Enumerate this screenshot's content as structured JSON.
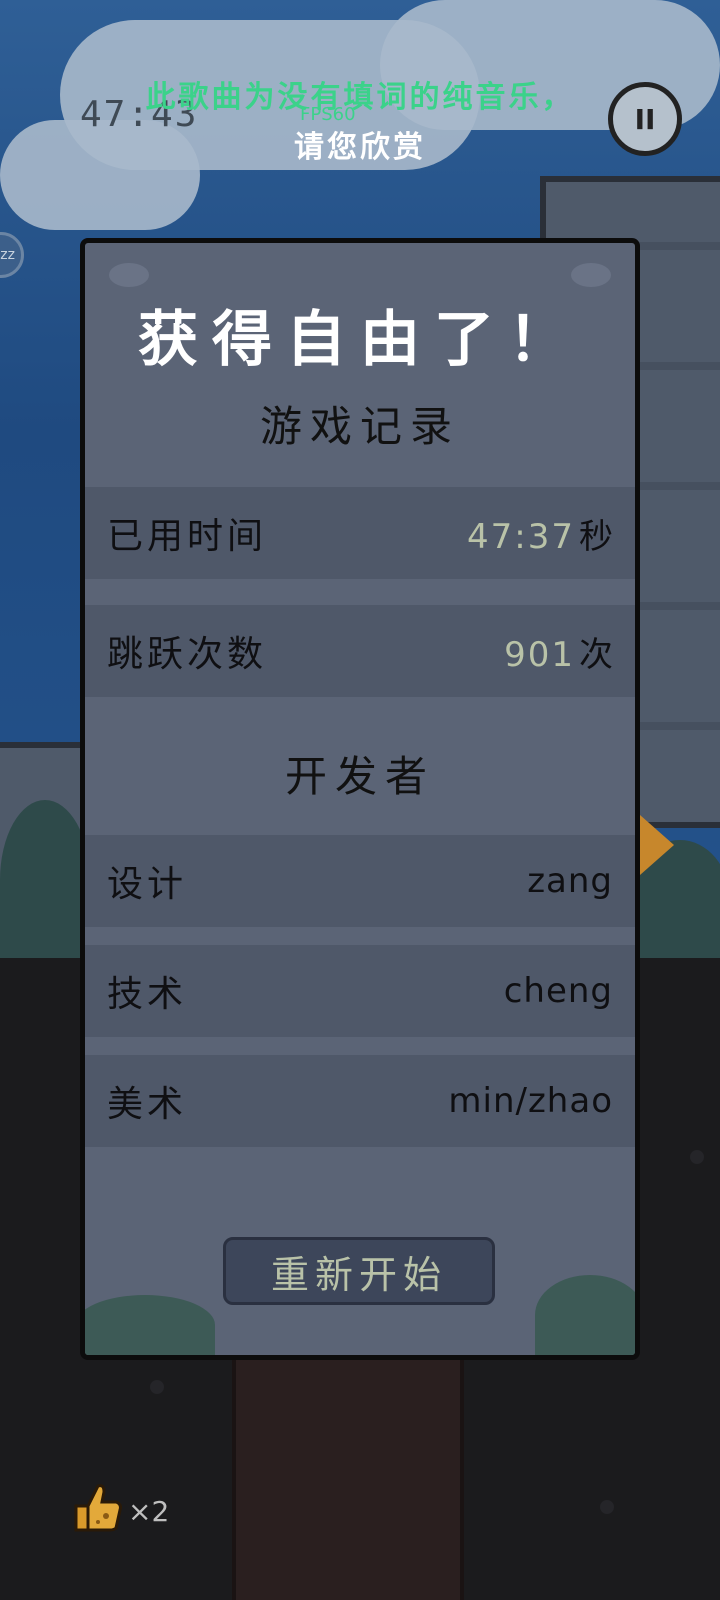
{
  "hud": {
    "lyric_line1": "此歌曲为没有填词的纯音乐，",
    "lyric_line2": "请您欣赏",
    "fps": "FPS60",
    "timer": "47:43",
    "pause_icon": "II",
    "side_button_icon": "zz"
  },
  "dialog": {
    "title": "获得自由了！",
    "record_heading": "游戏记录",
    "time_label": "已用时间",
    "time_value": "47:37",
    "time_unit": "秒",
    "jumps_label": "跳跃次数",
    "jumps_value": "901",
    "jumps_unit": "次",
    "dev_heading": "开发者",
    "design_label": "设计",
    "design_value": "zang",
    "tech_label": "技术",
    "tech_value": "cheng",
    "art_label": "美术",
    "art_value": "min/zhao",
    "restart_label": "重新开始"
  },
  "inventory": {
    "item_icon": "thumbs-up-icon",
    "item_count": "×2"
  },
  "colors": {
    "lyric_green": "#3bd28a",
    "dialog_bg": "#5b6476",
    "row_bg": "#4f5869",
    "value_text": "#b9c2a8"
  }
}
